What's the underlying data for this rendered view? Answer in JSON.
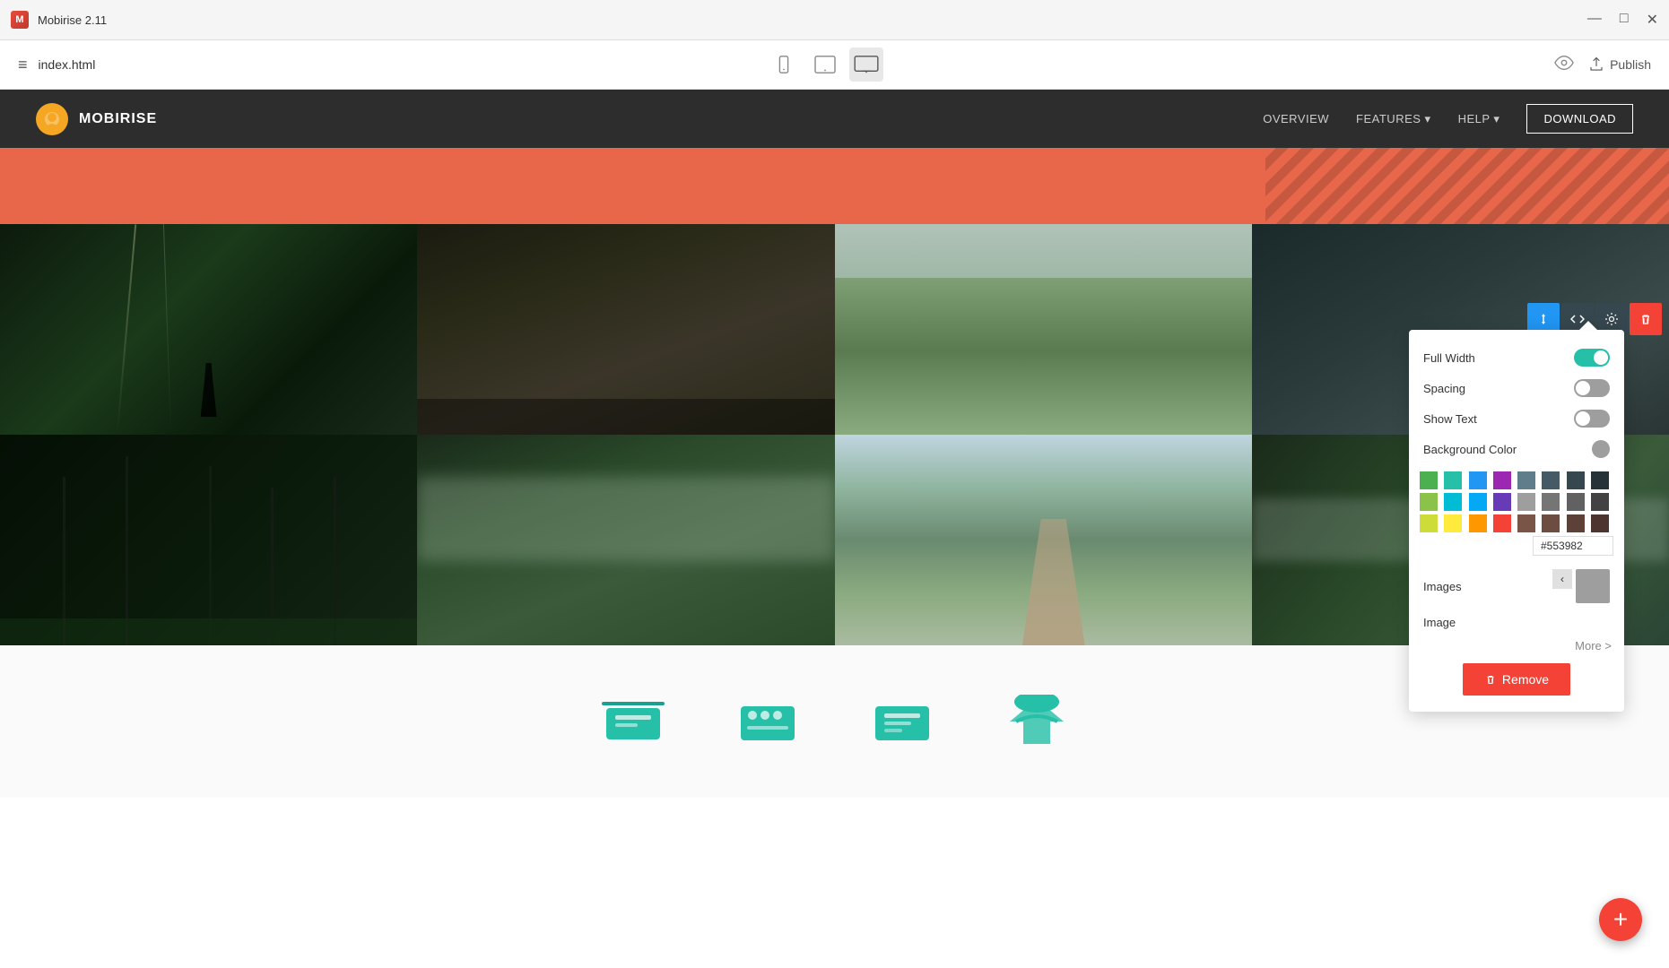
{
  "titlebar": {
    "logo_text": "M",
    "title": "Mobirise 2.11",
    "controls": {
      "minimize": "—",
      "maximize": "□",
      "close": "✕"
    }
  },
  "toolbar": {
    "hamburger": "≡",
    "filename": "index.html",
    "devices": {
      "mobile_label": "mobile",
      "tablet_label": "tablet",
      "desktop_label": "desktop"
    },
    "publish_label": "Publish",
    "publish_icon": "☁"
  },
  "site_nav": {
    "brand_name": "MOBIRISE",
    "overview": "OVERVIEW",
    "features": "FEATURES ▾",
    "help": "HELP ▾",
    "download": "DOWNLOAD"
  },
  "settings_panel": {
    "full_width_label": "Full Width",
    "full_width_on": true,
    "spacing_label": "Spacing",
    "spacing_on": false,
    "show_text_label": "Show Text",
    "show_text_on": false,
    "bg_color_label": "Background Color",
    "images_label": "Images",
    "image_label": "Image",
    "more_label": "More >",
    "remove_label": "Remove"
  },
  "color_hex": "#553982",
  "colors": {
    "row1": [
      "#4caf50",
      "#26bfa8",
      "#2196f3",
      "#9c27b0",
      "#607d8b",
      "#455a64",
      "#37474f",
      "#263238"
    ],
    "row2": [
      "#8bc34a",
      "#00bcd4",
      "#03a9f4",
      "#673ab7",
      "#9e9e9e",
      "#757575",
      "#616161",
      "#424242"
    ],
    "row3": [
      "#cddc39",
      "#ffeb3b",
      "#ff9800",
      "#f44336",
      "#795548",
      "#6d4c41",
      "#5d4037",
      "#4e342e"
    ]
  },
  "block_controls": {
    "arrange_icon": "⇅",
    "code_icon": "</>",
    "settings_icon": "⚙",
    "delete_icon": "🗑"
  },
  "fab": {
    "icon": "+"
  }
}
